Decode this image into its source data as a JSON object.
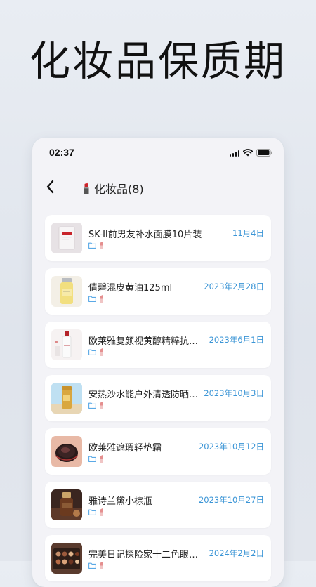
{
  "hero": {
    "title": "化妆品保质期"
  },
  "status_bar": {
    "time": "02:37"
  },
  "nav": {
    "title": "化妆品(8)"
  },
  "colors": {
    "accent_date": "#3b95d6",
    "tag_blue": "#5aa9e6",
    "tag_lipstick": "#e58f8f"
  },
  "items": [
    {
      "name": "SK-II前男友补水面膜10片装",
      "date": "11月4日",
      "thumb_icon": "face-mask-icon"
    },
    {
      "name": "倩碧混皮黄油125ml",
      "date": "2023年2月28日",
      "thumb_icon": "lotion-bottle-icon"
    },
    {
      "name": "欧莱雅复颜视黄醇精粹抗…",
      "date": "2023年6月1日",
      "thumb_icon": "serum-bottle-icon"
    },
    {
      "name": "安热沙水能户外清透防晒…",
      "date": "2023年10月3日",
      "thumb_icon": "sunscreen-icon"
    },
    {
      "name": "欧莱雅遮瑕轻垫霜",
      "date": "2023年10月12日",
      "thumb_icon": "cushion-compact-icon"
    },
    {
      "name": "雅诗兰黛小棕瓶",
      "date": "2023年10月27日",
      "thumb_icon": "brown-bottle-icon"
    },
    {
      "name": "完美日记探险家十二色眼…",
      "date": "2024年2月2日",
      "thumb_icon": "eyeshadow-palette-icon"
    }
  ]
}
